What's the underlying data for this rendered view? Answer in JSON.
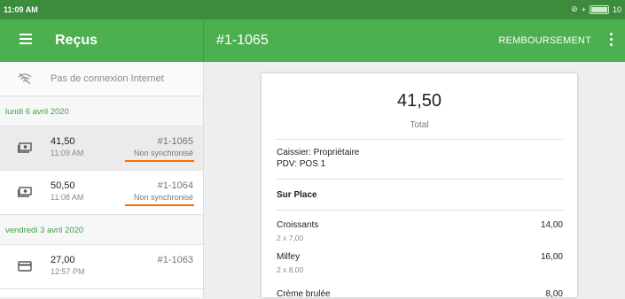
{
  "status_bar": {
    "time": "11:09 AM",
    "battery": "10"
  },
  "app_bar": {
    "title": "Reçus",
    "receipt_id": "#1-1065",
    "refund_label": "REMBOURSEMENT"
  },
  "sidebar": {
    "offline_text": "Pas de connexion Internet",
    "groups": [
      {
        "date": "lundi 6 avril 2020",
        "receipts": [
          {
            "amount": "41,50",
            "time": "11:09 AM",
            "number": "#1-1065",
            "status": "Non synchronisé",
            "icon": "cash-icon",
            "selected": true
          },
          {
            "amount": "50,50",
            "time": "11:08 AM",
            "number": "#1-1064",
            "status": "Non synchronisé",
            "icon": "cash-icon",
            "selected": false
          }
        ]
      },
      {
        "date": "vendredi 3 avril 2020",
        "receipts": [
          {
            "amount": "27,00",
            "time": "12:57 PM",
            "number": "#1-1063",
            "status": "",
            "icon": "card-icon",
            "selected": false
          }
        ]
      }
    ]
  },
  "receipt": {
    "total": "41,50",
    "total_label": "Total",
    "cashier": "Caissier: Propriétaire",
    "pos": "PDV: POS 1",
    "dining_option": "Sur Place",
    "items": [
      {
        "name": "Croissants",
        "qty": "2 x 7,00",
        "price": "14,00"
      },
      {
        "name": "Milfey",
        "qty": "2 x 8,00",
        "price": "16,00"
      },
      {
        "name": "Crème brulée",
        "qty": "",
        "price": "8,00"
      }
    ]
  },
  "colors": {
    "primary": "#4caf50",
    "status_bar": "#3d8b3d",
    "accent_underline": "#ff6d00",
    "date_text": "#43a047"
  }
}
